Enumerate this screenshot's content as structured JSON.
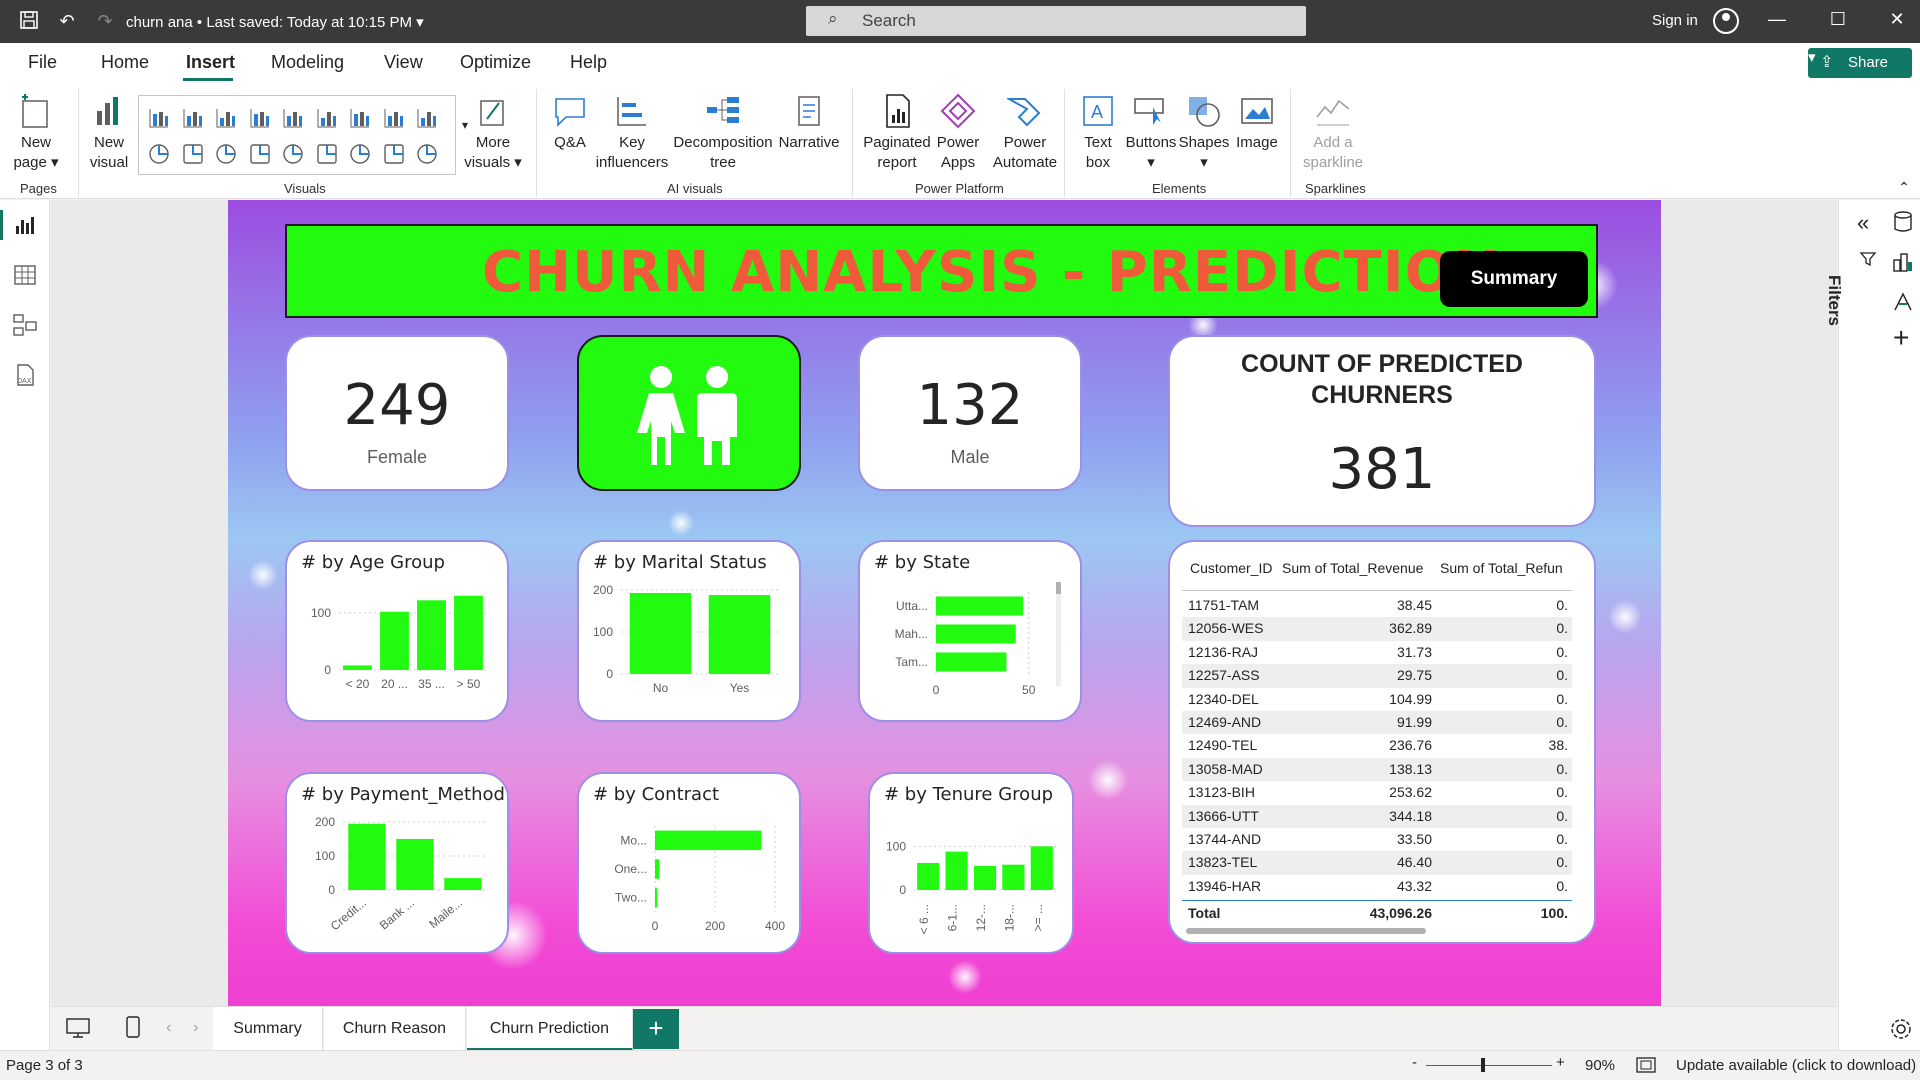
{
  "titlebar": {
    "doc_title": "churn ana",
    "saved": "Last saved: Today at 10:15 PM",
    "search_placeholder": "Search",
    "signin": "Sign in"
  },
  "menu": [
    "File",
    "Home",
    "Insert",
    "Modeling",
    "View",
    "Optimize",
    "Help"
  ],
  "share_label": "Share",
  "ribbon": {
    "new_page": [
      "New",
      "page"
    ],
    "new_visual": [
      "New",
      "visual"
    ],
    "more_visuals": [
      "More",
      "visuals"
    ],
    "qa": "Q&A",
    "key_influencers": [
      "Key",
      "influencers"
    ],
    "decomposition_tree": [
      "Decomposition",
      "tree"
    ],
    "narrative": "Narrative",
    "paginated_report": [
      "Paginated",
      "report"
    ],
    "power_apps": [
      "Power",
      "Apps"
    ],
    "power_automate": [
      "Power",
      "Automate"
    ],
    "text_box": [
      "Text",
      "box"
    ],
    "buttons": "Buttons",
    "shapes": "Shapes",
    "image": "Image",
    "add_sparkline": [
      "Add a",
      "sparkline"
    ],
    "groups": {
      "pages": "Pages",
      "visuals": "Visuals",
      "ai_visuals": "AI visuals",
      "power_platform": "Power Platform",
      "elements": "Elements",
      "sparklines": "Sparklines"
    }
  },
  "report": {
    "title": "CHURN ANALYSIS - PREDICTION",
    "summary_button": "Summary",
    "female_count": "249",
    "female_label": "Female",
    "male_count": "132",
    "male_label": "Male",
    "predicted_title_1": "COUNT OF PREDICTED",
    "predicted_title_2": "CHURNERS",
    "predicted_count": "381",
    "chart_titles": {
      "age": "# by Age Group",
      "marital": "# by Marital Status",
      "state": "# by State",
      "payment": "# by Payment_Method",
      "contract": "# by Contract",
      "tenure": "# by Tenure Group"
    }
  },
  "chart_data": [
    {
      "id": "age",
      "type": "bar",
      "title": "# by Age Group",
      "categories": [
        "< 20",
        "20 ...",
        "35 ...",
        "> 50"
      ],
      "values": [
        8,
        102,
        122,
        130
      ],
      "y_ticks": [
        0,
        100
      ],
      "ylim": [
        0,
        140
      ],
      "color": "#22fb10"
    },
    {
      "id": "marital",
      "type": "bar",
      "title": "# by Marital Status",
      "categories": [
        "No",
        "Yes"
      ],
      "values": [
        193,
        188
      ],
      "y_ticks": [
        0,
        100,
        200
      ],
      "ylim": [
        0,
        200
      ],
      "color": "#22fb10"
    },
    {
      "id": "state",
      "type": "bar",
      "orientation": "horizontal",
      "title": "# by State",
      "categories": [
        "Utta...",
        "Mah...",
        "Tam..."
      ],
      "values": [
        47,
        43,
        38
      ],
      "x_ticks": [
        0,
        50
      ],
      "xlim": [
        0,
        55
      ],
      "color": "#22fb10"
    },
    {
      "id": "payment",
      "type": "bar",
      "title": "# by Payment_Method",
      "categories": [
        "Credit...",
        "Bank ...",
        "Maile..."
      ],
      "values": [
        195,
        150,
        35
      ],
      "y_ticks": [
        0,
        100,
        200
      ],
      "ylim": [
        0,
        200
      ],
      "color": "#22fb10"
    },
    {
      "id": "contract",
      "type": "bar",
      "orientation": "horizontal",
      "title": "# by Contract",
      "categories": [
        "Mo...",
        "One...",
        "Two..."
      ],
      "values": [
        355,
        15,
        8
      ],
      "x_ticks": [
        0,
        200,
        400
      ],
      "xlim": [
        0,
        400
      ],
      "color": "#22fb10"
    },
    {
      "id": "tenure",
      "type": "bar",
      "title": "# by Tenure Group",
      "categories": [
        "< 6 ...",
        "6-1...",
        "12-...",
        "18-...",
        ">= ..."
      ],
      "values": [
        62,
        88,
        55,
        58,
        100
      ],
      "y_ticks": [
        0,
        100
      ],
      "ylim": [
        0,
        110
      ],
      "color": "#22fb10"
    },
    {
      "id": "customer_table",
      "type": "table",
      "columns": [
        "Customer_ID",
        "Sum of Total_Revenue",
        "Sum of Total_Refun"
      ],
      "rows": [
        [
          "11751-TAM",
          "38.45",
          "0."
        ],
        [
          "12056-WES",
          "362.89",
          "0."
        ],
        [
          "12136-RAJ",
          "31.73",
          "0."
        ],
        [
          "12257-ASS",
          "29.75",
          "0."
        ],
        [
          "12340-DEL",
          "104.99",
          "0."
        ],
        [
          "12469-AND",
          "91.99",
          "0."
        ],
        [
          "12490-TEL",
          "236.76",
          "38."
        ],
        [
          "13058-MAD",
          "138.13",
          "0."
        ],
        [
          "13123-BIH",
          "253.62",
          "0."
        ],
        [
          "13666-UTT",
          "344.18",
          "0."
        ],
        [
          "13744-AND",
          "33.50",
          "0."
        ],
        [
          "13823-TEL",
          "46.40",
          "0."
        ],
        [
          "13946-HAR",
          "43.32",
          "0."
        ]
      ],
      "total": [
        "Total",
        "43,096.26",
        "100."
      ]
    }
  ],
  "tabs": [
    "Summary",
    "Churn Reason",
    "Churn Prediction"
  ],
  "active_tab": "Churn Prediction",
  "right_pane": {
    "filters": "Filters"
  },
  "status": {
    "page": "Page 3 of 3",
    "zoom": "90%",
    "update": "Update available (click to download)"
  },
  "colors": {
    "accent": "#117865",
    "bar": "#22fb10",
    "title_red": "#ef5a3a"
  }
}
